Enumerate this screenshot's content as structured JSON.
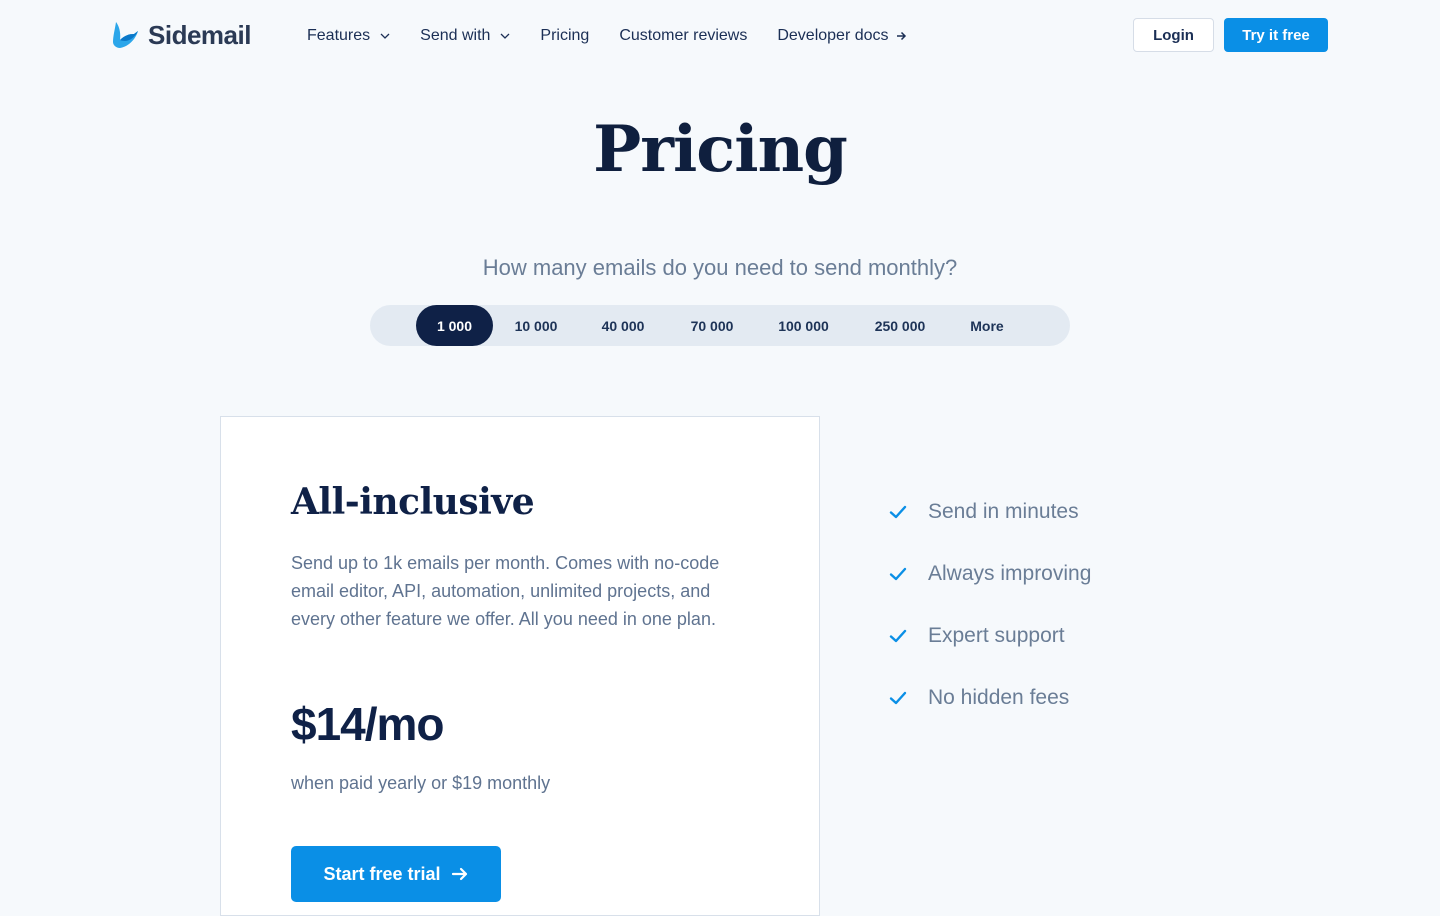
{
  "header": {
    "logo_text": "Sidemail",
    "nav": [
      {
        "label": "Features",
        "has_dropdown": true
      },
      {
        "label": "Send with",
        "has_dropdown": true
      },
      {
        "label": "Pricing",
        "has_dropdown": false
      },
      {
        "label": "Customer reviews",
        "has_dropdown": false
      },
      {
        "label": "Developer docs",
        "has_dropdown": false,
        "external_arrow": true
      }
    ],
    "login_label": "Login",
    "try_label": "Try it free"
  },
  "hero": {
    "title": "Pricing",
    "question": "How many emails do you need to send monthly?"
  },
  "volume_selector": {
    "options": [
      "1 000",
      "10 000",
      "40 000",
      "70 000",
      "100 000",
      "250 000",
      "More"
    ],
    "selected": "1 000"
  },
  "plan": {
    "title": "All-inclusive",
    "description": "Send up to 1k emails per month. Comes with no-code email editor, API, automation, unlimited projects, and every other feature we offer. All you need in one plan.",
    "price": "$14/mo",
    "price_note": "when paid yearly or $19 monthly",
    "cta_label": "Start free trial"
  },
  "features": [
    "Send in minutes",
    "Always improving",
    "Expert support",
    "No hidden fees"
  ],
  "colors": {
    "background": "#f6f9fc",
    "accent": "#0a8fe6",
    "navy": "#0f2147",
    "muted_text": "#6a7d96",
    "check": "#0a8fe6"
  }
}
